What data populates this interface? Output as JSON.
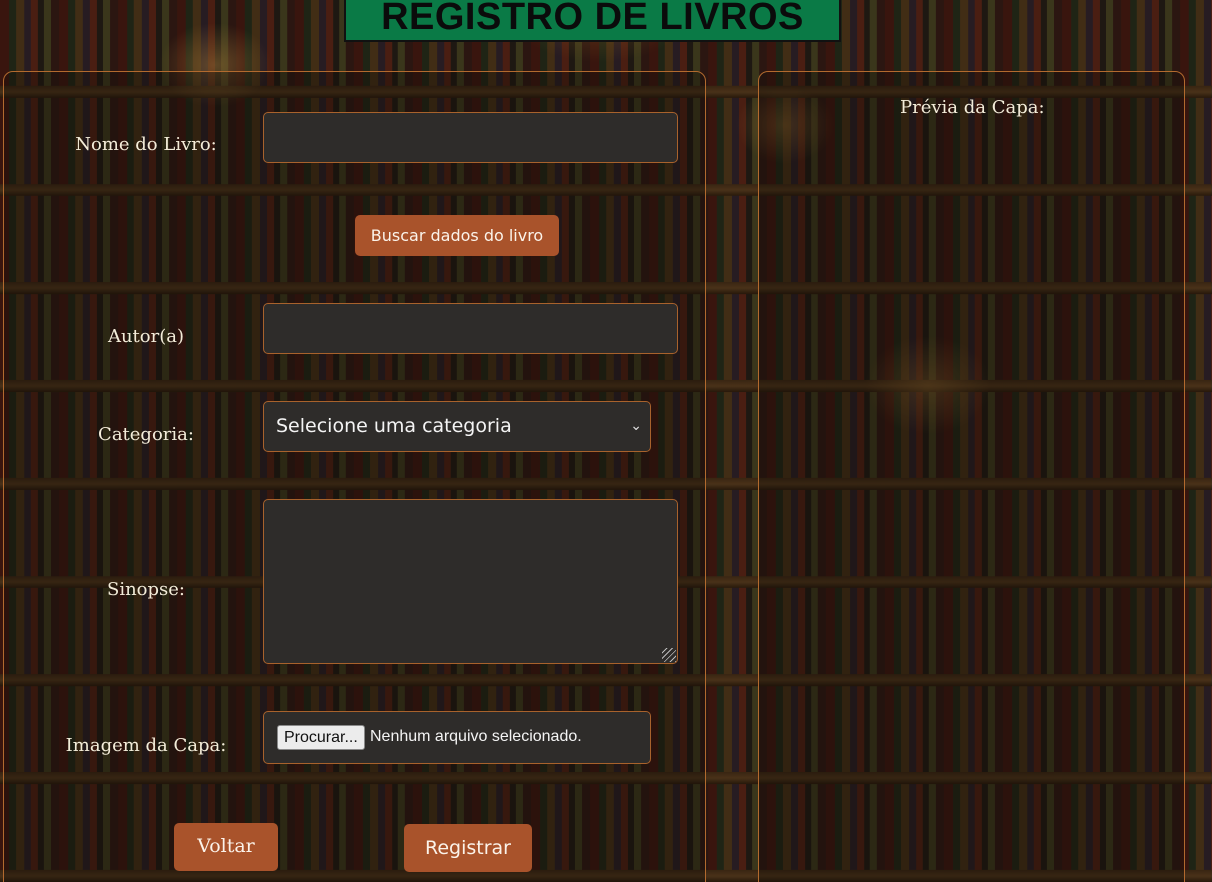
{
  "header": {
    "title": "REGISTRO DE LIVROS"
  },
  "form": {
    "book_name": {
      "label": "Nome do Livro:",
      "value": ""
    },
    "search_button_label": "Buscar dados do livro",
    "author": {
      "label": "Autor(a)",
      "value": ""
    },
    "category": {
      "label": "Categoria:",
      "selected": "Selecione uma categoria"
    },
    "synopsis": {
      "label": "Sinopse:",
      "value": ""
    },
    "cover_image": {
      "label": "Imagem da Capa:",
      "browse_label": "Procurar...",
      "status": "Nenhum arquivo selecionado."
    },
    "back_button_label": "Voltar",
    "register_button_label": "Registrar"
  },
  "preview": {
    "label": "Prévia da Capa:"
  },
  "colors": {
    "title_background": "#0a7a46",
    "button": "#a9532b",
    "field_background": "#2e2c2a",
    "field_border": "#a8622c",
    "panel_border": "#b26a2e"
  }
}
